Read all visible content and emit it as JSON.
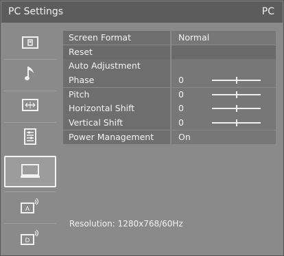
{
  "header": {
    "title": "PC Settings",
    "source": "PC"
  },
  "sidebar": {
    "items": [
      {
        "icon": "picture-icon"
      },
      {
        "icon": "music-note-icon"
      },
      {
        "icon": "screen-format-icon"
      },
      {
        "icon": "settings-list-icon"
      },
      {
        "icon": "pc-monitor-icon",
        "active": true
      },
      {
        "icon": "analog-signal-icon",
        "letter": "A"
      },
      {
        "icon": "digital-signal-icon",
        "letter": "D"
      }
    ]
  },
  "menu": {
    "rows": [
      {
        "label": "Screen Format",
        "value": "Normal"
      },
      {
        "label": "Reset",
        "value": ""
      },
      {
        "label": "Auto Adjustment",
        "value": ""
      },
      {
        "label": "Phase",
        "value": "0",
        "slider": 0.5
      },
      {
        "label": "Pitch",
        "value": "0",
        "slider": 0.5
      },
      {
        "label": "Horizontal Shift",
        "value": "0",
        "slider": 0.5
      },
      {
        "label": "Vertical Shift",
        "value": "0",
        "slider": 0.5
      },
      {
        "label": "Power Management",
        "value": "On"
      }
    ]
  },
  "status": {
    "resolution": "Resolution: 1280x768/60Hz"
  },
  "colors": {
    "background": "#8a8a8a",
    "titlebar": "#5c5c5c",
    "row": "#6e6e6e",
    "text": "#f5f5f5"
  }
}
